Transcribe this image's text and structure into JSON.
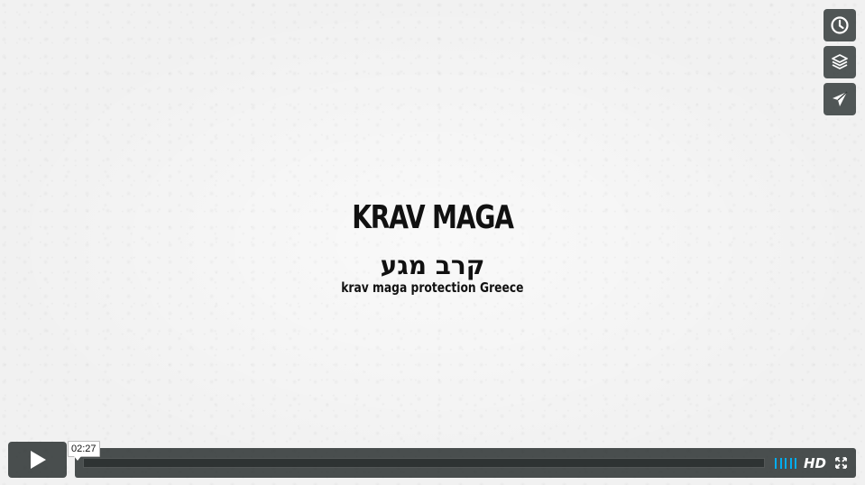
{
  "video": {
    "title_main": "KRAV MAGA",
    "title_hebrew": "קרב מגע",
    "title_sub": "krav maga protection Greece"
  },
  "side_buttons": [
    {
      "icon": "clock-icon",
      "label": "Watch Later"
    },
    {
      "icon": "layers-icon",
      "label": "Collections"
    },
    {
      "icon": "paper-plane-icon",
      "label": "Share"
    }
  ],
  "player": {
    "timecode": "02:27",
    "progress": 0.0,
    "volume_level": 1.0,
    "hd_label": "HD",
    "accent_color": "#00adef"
  }
}
